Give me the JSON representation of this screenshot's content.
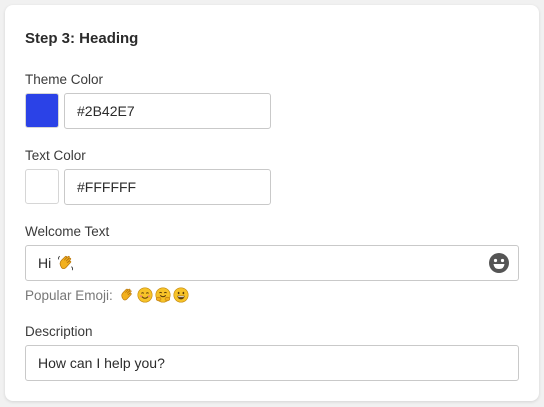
{
  "heading": "Step 3: Heading",
  "theme_color": {
    "label": "Theme Color",
    "value": "#2B42E7",
    "swatch": "#2B42E7"
  },
  "text_color": {
    "label": "Text Color",
    "value": "#FFFFFF",
    "swatch": "#FFFFFF"
  },
  "welcome_text": {
    "label": "Welcome Text",
    "value": "Hi",
    "value_emoji": "waving-hand-icon",
    "picker_icon": "smiley-face-icon"
  },
  "popular_emoji": {
    "label": "Popular Emoji:",
    "items": [
      "waving-hand-icon",
      "smiling-face-icon",
      "hugging-face-icon",
      "grinning-face-icon"
    ]
  },
  "description": {
    "label": "Description",
    "value": "How can I help you?"
  }
}
